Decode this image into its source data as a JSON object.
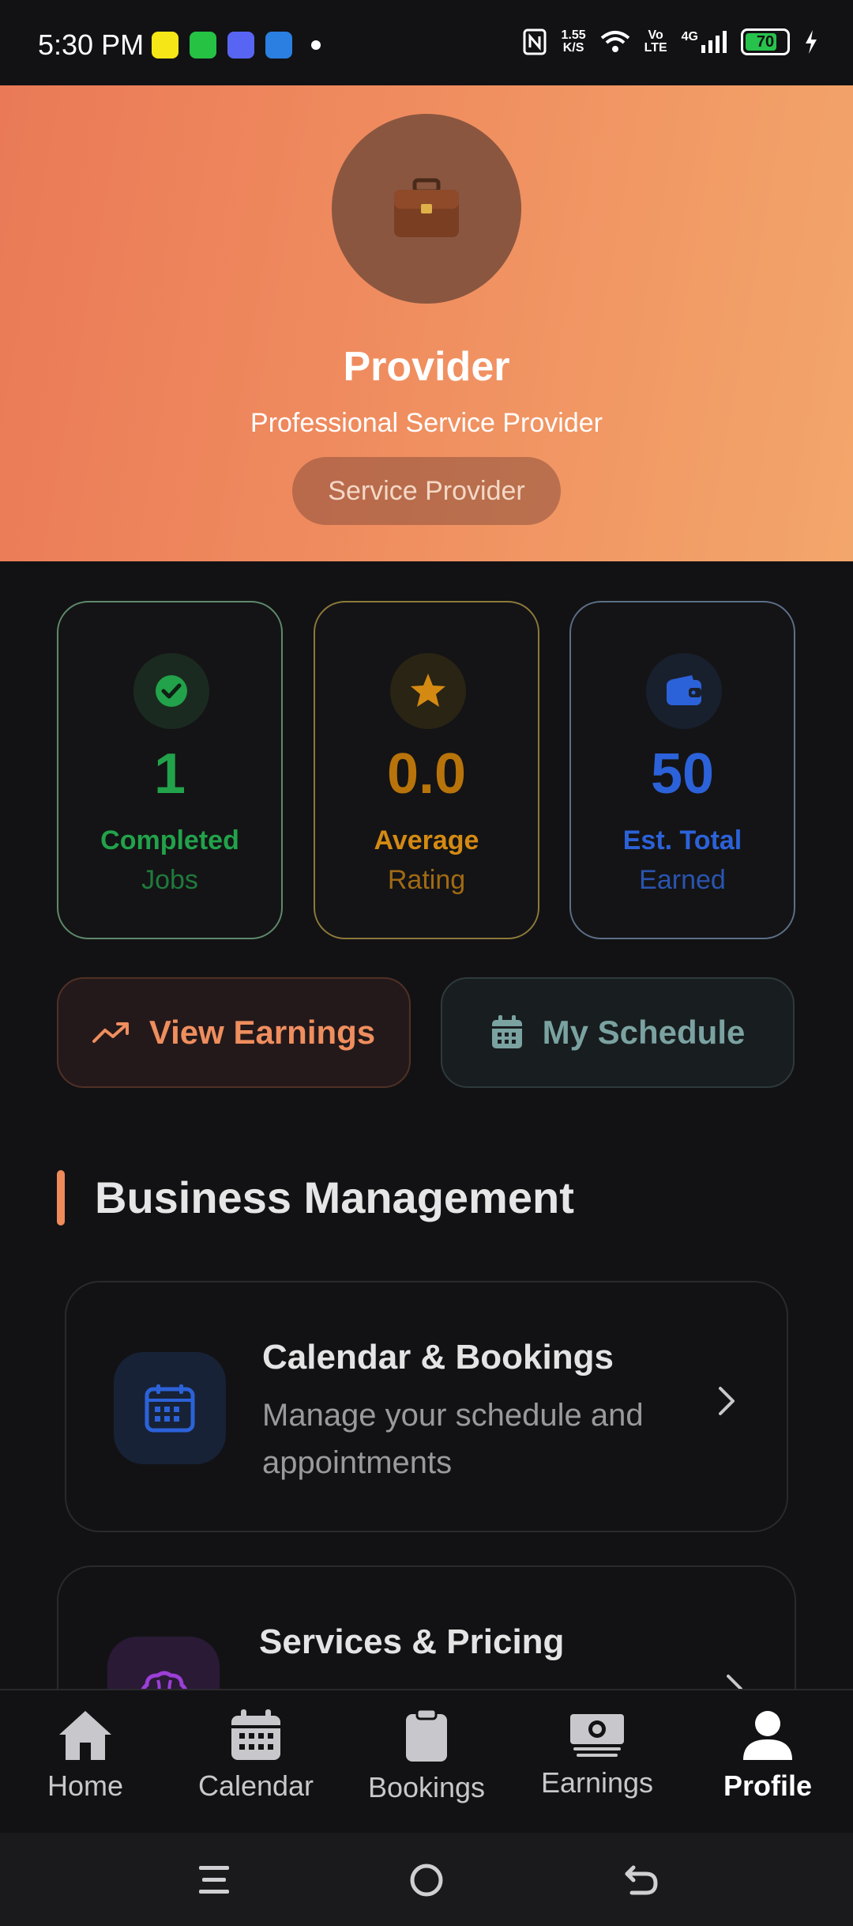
{
  "status_bar": {
    "time": "5:30 PM",
    "speed_value": "1.55",
    "speed_unit": "K/S",
    "volte_top": "Vo",
    "volte_bottom": "LTE",
    "network": "4G",
    "battery": "70"
  },
  "profile": {
    "name": "Provider",
    "subtitle": "Professional Service Provider",
    "badge": "Service Provider",
    "avatar_icon": "briefcase-icon"
  },
  "stats": [
    {
      "value": "1",
      "label_top": "Completed",
      "label_bottom": "Jobs",
      "icon": "check-circle-icon",
      "color": "#22a24a"
    },
    {
      "value": "0.0",
      "label_top": "Average",
      "label_bottom": "Rating",
      "icon": "star-icon",
      "color": "#d48a12"
    },
    {
      "value": "50",
      "label_top": "Est. Total",
      "label_bottom": "Earned",
      "icon": "wallet-icon",
      "color": "#2c62d9"
    }
  ],
  "actions": {
    "earnings_label": "View Earnings",
    "schedule_label": "My Schedule"
  },
  "section": {
    "title": "Business Management"
  },
  "management": [
    {
      "title": "Calendar & Bookings",
      "description": "Manage your schedule and appointments",
      "icon": "calendar-icon"
    },
    {
      "title": "Services & Pricing",
      "icon": "brain-icon"
    }
  ],
  "bottom_nav": [
    {
      "label": "Home",
      "icon": "home-icon",
      "active": false
    },
    {
      "label": "Calendar",
      "icon": "calendar-icon",
      "active": false
    },
    {
      "label": "Bookings",
      "icon": "clipboard-icon",
      "active": false
    },
    {
      "label": "Earnings",
      "icon": "money-icon",
      "active": false
    },
    {
      "label": "Profile",
      "icon": "user-icon",
      "active": true
    }
  ],
  "colors": {
    "accent_orange": "#ef8a5a",
    "background": "#121214",
    "success": "#22a24a",
    "warning": "#d48a12",
    "info": "#2c62d9"
  }
}
